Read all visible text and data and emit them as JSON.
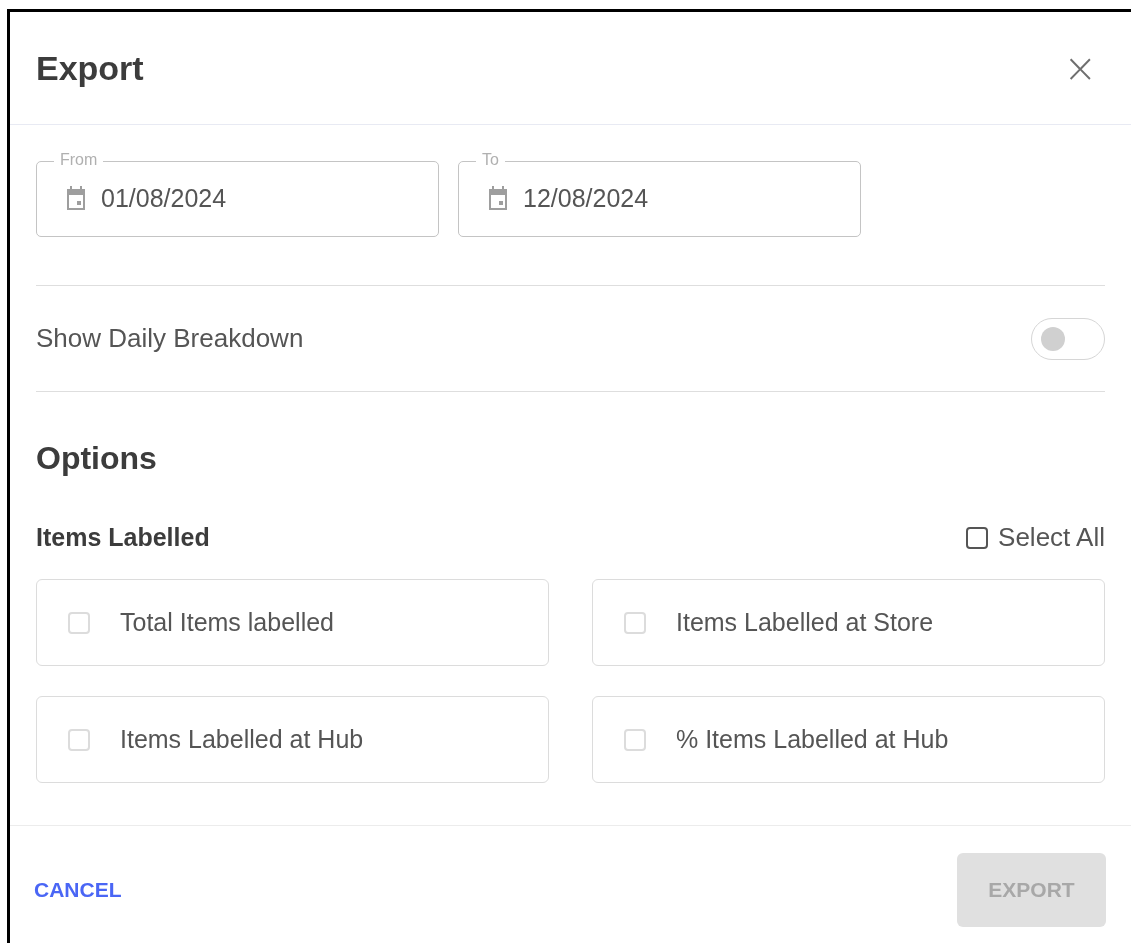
{
  "dialog": {
    "title": "Export",
    "close": "×"
  },
  "date_fields": [
    {
      "label": "From",
      "value": "01/08/2024"
    },
    {
      "label": "To",
      "value": "12/08/2024"
    }
  ],
  "daily_breakdown": {
    "label": "Show Daily Breakdown",
    "on": false
  },
  "options": {
    "title": "Options",
    "group_title": "Items Labelled",
    "select_all": {
      "label": "Select All",
      "checked": false
    },
    "items": [
      {
        "label": "Total Items labelled",
        "checked": false
      },
      {
        "label": "Items Labelled at Store",
        "checked": false
      },
      {
        "label": "Items Labelled at Hub",
        "checked": false
      },
      {
        "label": "% Items Labelled at Hub",
        "checked": false
      }
    ]
  },
  "footer": {
    "cancel": "CANCEL",
    "export": {
      "label": "EXPORT",
      "disabled": true
    }
  }
}
